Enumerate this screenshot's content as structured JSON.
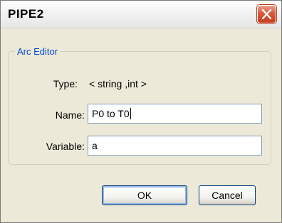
{
  "window": {
    "title": "PIPE2",
    "close_icon": "close-icon"
  },
  "arc_editor": {
    "group_label": "Arc Editor",
    "type_label": "Type:",
    "type_value": "< string ,int >",
    "name_label": "Name:",
    "name_value": "P0 to T0",
    "variable_label": "Variable:",
    "variable_value": "a"
  },
  "buttons": {
    "ok_label": "OK",
    "cancel_label": "Cancel"
  },
  "colors": {
    "dialog_background": "#ece9d8",
    "group_label_color": "#0046d5",
    "close_button": "#d9593a",
    "field_border": "#7f9db9",
    "default_button_border": "#003c74"
  }
}
